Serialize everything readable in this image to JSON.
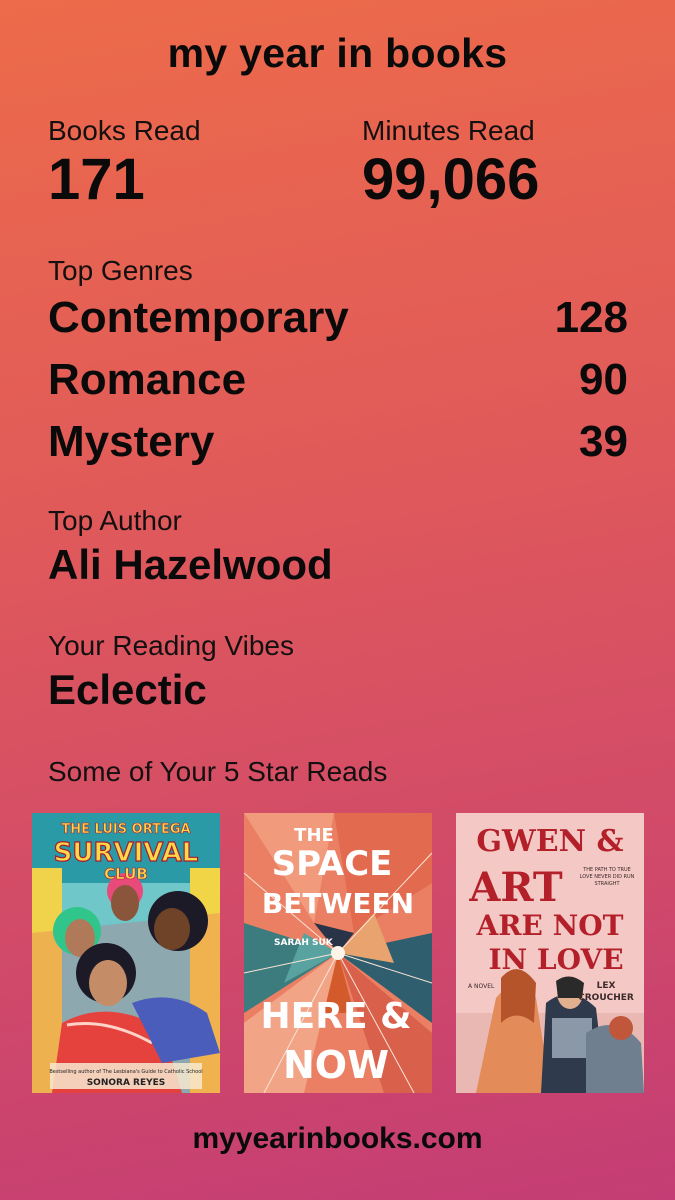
{
  "header": {
    "title": "my year in books"
  },
  "stats": {
    "books_read_label": "Books Read",
    "books_read_value": "171",
    "minutes_read_label": "Minutes Read",
    "minutes_read_value": "99,066"
  },
  "genres": {
    "label": "Top Genres",
    "items": [
      {
        "name": "Contemporary",
        "count": "128"
      },
      {
        "name": "Romance",
        "count": "90"
      },
      {
        "name": "Mystery",
        "count": "39"
      }
    ]
  },
  "top_author": {
    "label": "Top Author",
    "value": "Ali Hazelwood"
  },
  "vibes": {
    "label": "Your Reading Vibes",
    "value": "Eclectic"
  },
  "five_star": {
    "label": "Some of Your 5 Star Reads",
    "books": [
      {
        "title_line1": "THE LUIS ORTEGA",
        "title_line2": "SURVIVAL",
        "title_line3": "CLUB",
        "blurb": "Bestselling author of The Lesbiana's Guide to Catholic School",
        "author": "SONORA REYES"
      },
      {
        "title_line1": "THE",
        "title_line2": "SPACE",
        "title_line3": "BETWEEN",
        "title_line4": "HERE &",
        "title_line5": "NOW",
        "author": "SARAH SUK"
      },
      {
        "title_line1": "GWEN &",
        "title_line2": "ART",
        "title_line3": "ARE NOT",
        "title_line4": "IN LOVE",
        "tagline": "THE PATH TO TRUE LOVE NEVER DID RUN STRAIGHT",
        "novel_tag": "A NOVEL",
        "author_line1": "LEX",
        "author_line2": "CROUCHER"
      }
    ]
  },
  "footer": {
    "site": "myyearinbooks.com"
  },
  "colors": {
    "gradient_top": "#ed6b4a",
    "gradient_bottom": "#c43d74",
    "text": "#0a0a0a",
    "gwen_title_red": "#b3202a"
  }
}
